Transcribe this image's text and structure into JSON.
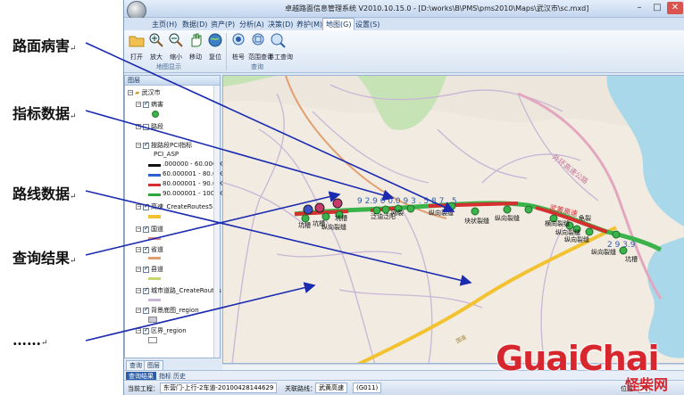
{
  "annotations": [
    {
      "label": "路面病害",
      "mark": "↵"
    },
    {
      "label": "指标数据",
      "mark": "↵"
    },
    {
      "label": "路线数据",
      "mark": "↵"
    },
    {
      "label": "查询结果",
      "mark": "↵"
    },
    {
      "label": "……",
      "mark": "↵"
    }
  ],
  "window": {
    "title": "卓越路面信息管理系统 V2010.10.15.0 - [D:\\works\\B\\PMS\\pms2010\\Maps\\武汉市\\sc.mxd]",
    "controls": {
      "minimize": "–",
      "maximize": "□",
      "close": "✕"
    }
  },
  "menu": {
    "items": [
      "主页(H)",
      "数据(D)",
      "资产(P)",
      "分析(A)",
      "决策(D)",
      "养护(M)",
      "地图(G)",
      "设置(S)"
    ],
    "active_index": 6
  },
  "ribbon": {
    "buttons": [
      "打开",
      "放大",
      "缩小",
      "移动",
      "复位",
      "桩号",
      "范围查询",
      "手工查询"
    ],
    "groups": [
      "地图显示",
      "查询"
    ]
  },
  "legend_panel": {
    "title": "图层",
    "root": "武汉市",
    "items": [
      {
        "label": "病害",
        "checked": true
      },
      {
        "label": "路段",
        "checked": false
      },
      {
        "label": "按路段PCI指标",
        "checked": true
      },
      {
        "label": "PCI_ASP",
        "checked": null
      },
      {
        "label": ".000000 - 60.00000",
        "color": "#111111"
      },
      {
        "label": "60.000001 - 80.000",
        "color": "#2d5fd3"
      },
      {
        "label": "80.000001 - 90.000",
        "color": "#d62f2f"
      },
      {
        "label": "90.000001 - 100.00",
        "color": "#2da83a"
      },
      {
        "label": "高速_CreateRoutes5",
        "checked": true
      },
      {
        "label": "国道",
        "checked": true
      },
      {
        "label": "省道",
        "checked": true
      },
      {
        "label": "县道",
        "checked": true
      },
      {
        "label": "城市道路_CreateRoutes",
        "checked": true
      },
      {
        "label": "背景底图_region",
        "checked": true
      },
      {
        "label": "区界_region",
        "checked": true
      }
    ],
    "tabs": [
      "查询",
      "图层"
    ]
  },
  "result_tabs": [
    "查询结果",
    "指标",
    "历史"
  ],
  "map": {
    "labels": {
      "city": "武汉市",
      "route_label": "武黄高速",
      "ring_road": "外环高速公路",
      "dir_label_1": "纵向裂缝",
      "dir_label_2": "块状裂缝",
      "dir_label_3": "纵向裂缝",
      "dir_label_4": "纵向裂缝",
      "dir_label_5": "坑槽",
      "dir_label_6": "坑槽",
      "dir_label_7": "坑槽",
      "dir_label_8": "网裂",
      "dir_label_9": "泛油泛阳",
      "dir_label_10": "纵向裂缝",
      "dir_label_11": "纵向裂缝",
      "dir_label_12": "横向裂缝",
      "dir_label_13": "纵向裂缝",
      "dir_label_14": "龟裂",
      "dir_label_15": "坑槽",
      "road_text_2": "国道",
      "pci_text": "9 2.9 0 0.0 9 3 . 5     8 7 . 5",
      "pci_text_end": "2 9 3.9"
    },
    "colors": {
      "route_green": "#3ab34a",
      "route_red": "#d62f2f",
      "highway_yellow": "#f2c230",
      "road_purple": "#c9b6d6",
      "water": "#a8d8ea",
      "land": "#f1ebe2",
      "green_area": "#c5e3b5"
    }
  },
  "status": {
    "current_project_label": "当前工程：",
    "current_project": "东营门-上行-2车道-20100428144629",
    "related_route_label": "关联路线：",
    "related_route": "武黄高速",
    "route_code": "(G011)",
    "position_label": "位置：",
    "position_value": "K"
  },
  "watermark": {
    "text": "GuaiChai",
    "chinese": "怪柴网",
    "color": "#d8262e"
  }
}
